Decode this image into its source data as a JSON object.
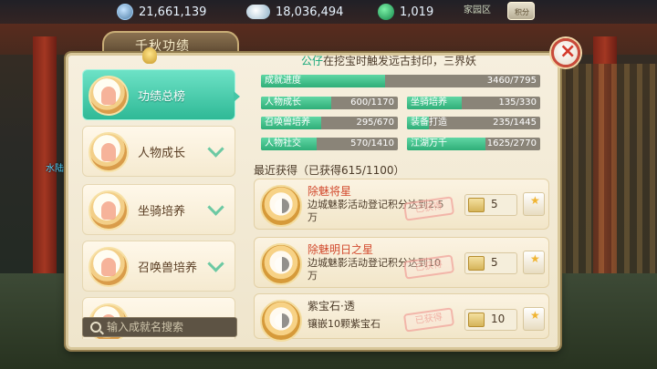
{
  "currencies": [
    {
      "icon": "coin-icon",
      "value": "21,661,139"
    },
    {
      "icon": "silver-ingot-icon",
      "value": "18,036,494"
    },
    {
      "icon": "jade-icon",
      "value": "1,019"
    }
  ],
  "topbar": {
    "tag": "家园区",
    "settings_label": "积分"
  },
  "scene": {
    "left_label": "水陆"
  },
  "panel": {
    "title": "千秋功绩",
    "headline_name": "公仔",
    "headline_text": "在挖宝时触发远古封印，三界妖"
  },
  "categories": [
    {
      "label": "功绩总榜",
      "active": true
    },
    {
      "label": "人物成长",
      "active": false
    },
    {
      "label": "坐骑培养",
      "active": false
    },
    {
      "label": "召唤兽培养",
      "active": false
    }
  ],
  "search": {
    "placeholder": "输入成就名搜索"
  },
  "progress": [
    {
      "label": "成就进度",
      "value": "3460/7795",
      "fraction": 0.444
    },
    {
      "label": "人物成长",
      "value": "600/1170",
      "fraction": 0.513
    },
    {
      "label": "坐骑培养",
      "value": "135/330",
      "fraction": 0.409
    },
    {
      "label": "召唤兽培养",
      "value": "295/670",
      "fraction": 0.44
    },
    {
      "label": "装备打造",
      "value": "235/1445",
      "fraction": 0.163
    },
    {
      "label": "人物社交",
      "value": "570/1410",
      "fraction": 0.404
    },
    {
      "label": "江湖万千",
      "value": "1625/2770",
      "fraction": 0.587
    }
  ],
  "recent": {
    "title": "最近获得（已获得615/1100）",
    "items": [
      {
        "name": "除魅将星",
        "desc": "边城魅影活动登记积分达到2.5万",
        "stamp": "已获得",
        "reward": "5"
      },
      {
        "name": "除魅明日之星",
        "desc": "边城魅影活动登记积分达到10万",
        "stamp": "已获得",
        "reward": "5"
      },
      {
        "name": "紫宝石·透",
        "desc": "镶嵌10颗紫宝石",
        "stamp": "已获得",
        "reward": "10"
      }
    ]
  },
  "colors": {
    "accent": "#2fb996",
    "highlight": "#18a87a",
    "achievement_name": "#d24a2e",
    "close": "#d43a2c"
  }
}
